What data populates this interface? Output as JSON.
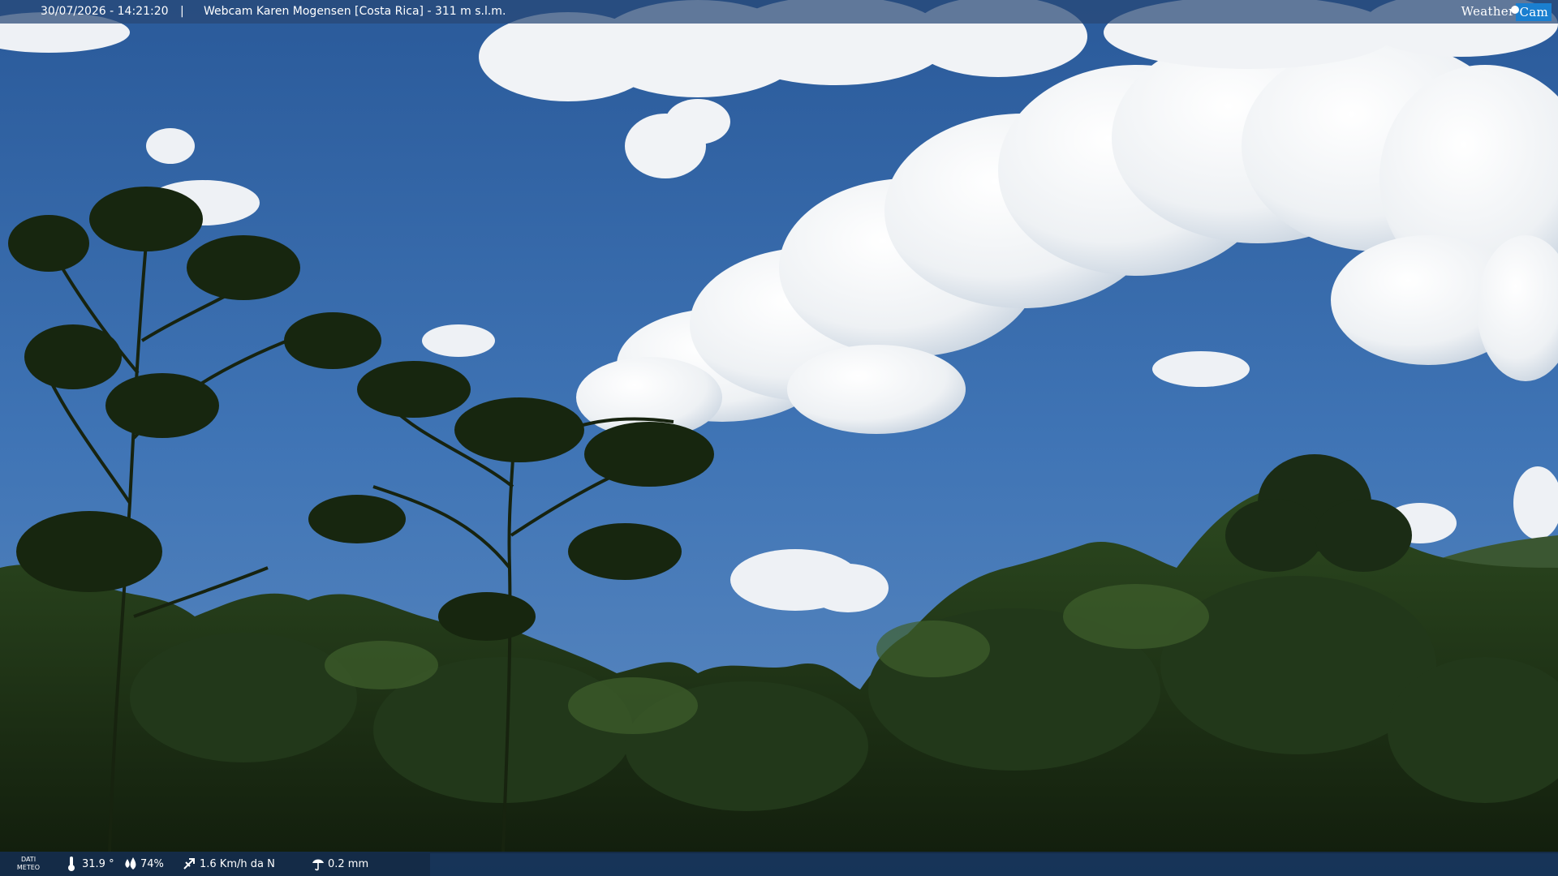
{
  "overlay": {
    "timestamp": "30/07/2026 - 14:21:20",
    "separator": "|",
    "title": "Webcam Karen Mogensen [Costa Rica] - 311 m s.l.m.",
    "logo_weather": "Weather",
    "logo_cam": "Cam"
  },
  "meteo": {
    "label_line1": "DATI",
    "label_line2": "METEO",
    "temperature": "31.9 °",
    "humidity": "74%",
    "wind": "1.6 Km/h da N",
    "rain": "0.2 mm"
  },
  "icons": {
    "temperature": "thermometer-icon",
    "humidity": "humidity-icon",
    "wind": "wind-icon",
    "rain": "rain-gauge-icon"
  },
  "colors": {
    "sky_top": "#2b5c9c",
    "sky_bottom": "#4a7fbd",
    "cloud": "#f2f4f6",
    "forest_dark": "#14220f",
    "forest_mid": "#2c4420",
    "bar_bg": "#284876"
  }
}
